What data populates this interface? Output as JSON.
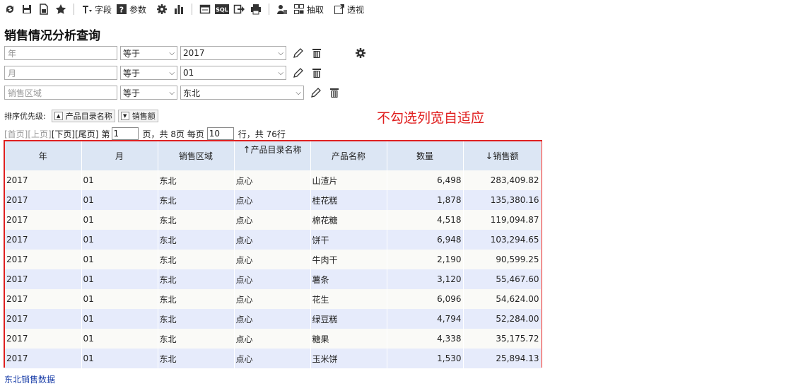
{
  "toolbar": {
    "field_label": "字段",
    "param_label": "参数",
    "extract_label": "抽取",
    "pivot_label": "透视",
    "sql_label": "SQL"
  },
  "title": "销售情况分析查询",
  "filters": [
    {
      "field_placeholder": "年",
      "op": "等于",
      "value": "2017"
    },
    {
      "field_placeholder": "月",
      "op": "等于",
      "value": "01"
    },
    {
      "field_placeholder": "销售区域",
      "op": "等于",
      "value": "东北"
    }
  ],
  "sort": {
    "label": "排序优先级:",
    "items": [
      {
        "name": "产品目录名称",
        "dir": "▲"
      },
      {
        "name": "销售额",
        "dir": "▼"
      }
    ]
  },
  "note": "不勾选列宽自适应",
  "pager": {
    "first": "[首页]",
    "prev": "[上页]",
    "next": "[下页]",
    "last": "[尾页]",
    "page_prefix": "第",
    "page": "1",
    "page_suffix": "页，共 8页 每页",
    "rows_per_page": "10",
    "rows_suffix": "行，共 76行"
  },
  "table": {
    "columns": [
      {
        "label": "年",
        "sort": ""
      },
      {
        "label": "月",
        "sort": ""
      },
      {
        "label": "销售区域",
        "sort": ""
      },
      {
        "label": "产品目录名称",
        "sort": "↑"
      },
      {
        "label": "产品名称",
        "sort": ""
      },
      {
        "label": "数量",
        "sort": ""
      },
      {
        "label": "销售额",
        "sort": "↓"
      }
    ],
    "rows": [
      [
        "2017",
        "01",
        "东北",
        "点心",
        "山渣片",
        "6,498",
        "283,409.82"
      ],
      [
        "2017",
        "01",
        "东北",
        "点心",
        "桂花糕",
        "1,878",
        "135,380.16"
      ],
      [
        "2017",
        "01",
        "东北",
        "点心",
        "棉花糖",
        "4,518",
        "119,094.87"
      ],
      [
        "2017",
        "01",
        "东北",
        "点心",
        "饼干",
        "6,948",
        "103,294.65"
      ],
      [
        "2017",
        "01",
        "东北",
        "点心",
        "牛肉干",
        "2,190",
        "90,599.25"
      ],
      [
        "2017",
        "01",
        "东北",
        "点心",
        "薯条",
        "3,120",
        "55,467.60"
      ],
      [
        "2017",
        "01",
        "东北",
        "点心",
        "花生",
        "6,096",
        "54,624.00"
      ],
      [
        "2017",
        "01",
        "东北",
        "点心",
        "绿豆糕",
        "4,794",
        "52,284.00"
      ],
      [
        "2017",
        "01",
        "东北",
        "点心",
        "糖果",
        "4,338",
        "35,175.72"
      ],
      [
        "2017",
        "01",
        "东北",
        "点心",
        "玉米饼",
        "1,530",
        "25,894.13"
      ]
    ]
  },
  "footer_link": "东北销售数据"
}
